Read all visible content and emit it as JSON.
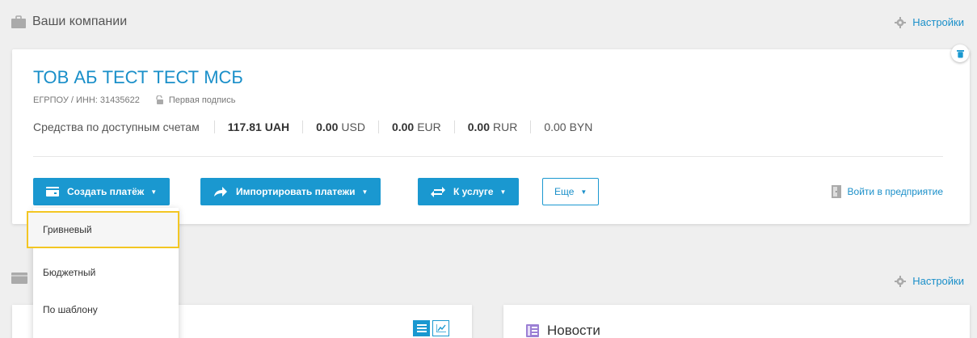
{
  "header": {
    "title": "Ваши компании",
    "settings_label": "Настройки"
  },
  "company": {
    "name": "ТОВ АБ ТЕСТ ТЕСТ МСБ",
    "tax_id": "ЕГРПОУ / ИНН: 31435622",
    "signature": "Первая подпись",
    "funds_label": "Средства по доступным счетам",
    "balances": [
      {
        "amount": "117.81",
        "currency": "UAH"
      },
      {
        "amount": "0.00",
        "currency": "USD"
      },
      {
        "amount": "0.00",
        "currency": "EUR"
      },
      {
        "amount": "0.00",
        "currency": "RUR"
      },
      {
        "amount": "0.00",
        "currency": "BYN"
      }
    ]
  },
  "actions": {
    "create_payment": "Создать платёж",
    "import_payments": "Импортировать платежи",
    "to_service": "К услуге",
    "more": "Еще",
    "enter_enterprise": "Войти в предприятие"
  },
  "dropdown": {
    "items": [
      "Гривневый",
      "Бюджетный",
      "По шаблону"
    ],
    "highlighted": "Гривневый"
  },
  "section2": {
    "settings_label": "Настройки"
  },
  "news": {
    "title": "Новости"
  },
  "colors": {
    "accent": "#1a98d0",
    "link": "#1a8fc9",
    "highlight": "#f3c623",
    "news_icon": "#9b7fd4"
  }
}
